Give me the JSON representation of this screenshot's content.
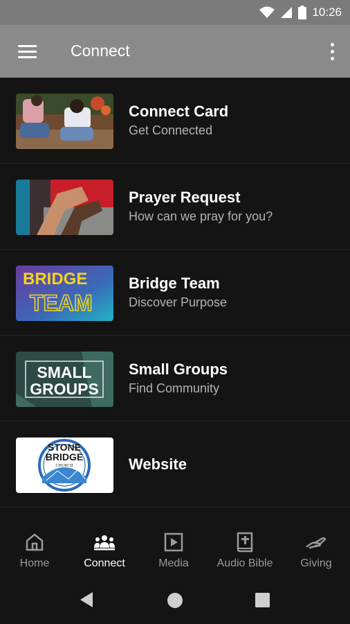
{
  "status": {
    "time": "10:26"
  },
  "app_bar": {
    "title": "Connect"
  },
  "items": [
    {
      "title": "Connect Card",
      "subtitle": "Get Connected"
    },
    {
      "title": "Prayer Request",
      "subtitle": "How can we pray for you?"
    },
    {
      "title": "Bridge Team",
      "subtitle": "Discover Purpose",
      "thumb_lines": [
        "BRIDGE",
        "TEAM"
      ]
    },
    {
      "title": "Small Groups",
      "subtitle": "Find Community",
      "thumb_lines": [
        "SMALL",
        "GROUPS"
      ]
    },
    {
      "title": "Website",
      "subtitle": "",
      "thumb_lines": [
        "STONE",
        "BRIDGE",
        "CHURCH"
      ]
    }
  ],
  "bottom_nav": [
    {
      "label": "Home",
      "icon": "home-icon",
      "active": false
    },
    {
      "label": "Connect",
      "icon": "people-icon",
      "active": true
    },
    {
      "label": "Media",
      "icon": "play-icon",
      "active": false
    },
    {
      "label": "Audio Bible",
      "icon": "bible-icon",
      "active": false
    },
    {
      "label": "Giving",
      "icon": "giving-hand-icon",
      "active": false
    }
  ],
  "colors": {
    "app_bar": "#8a8a8a",
    "status_bar": "#7b7b7b",
    "background": "#141414",
    "bridge_yellow": "#f5d320",
    "bridge_purple": "#5a3d9a",
    "bridge_teal": "#22b4c4"
  }
}
